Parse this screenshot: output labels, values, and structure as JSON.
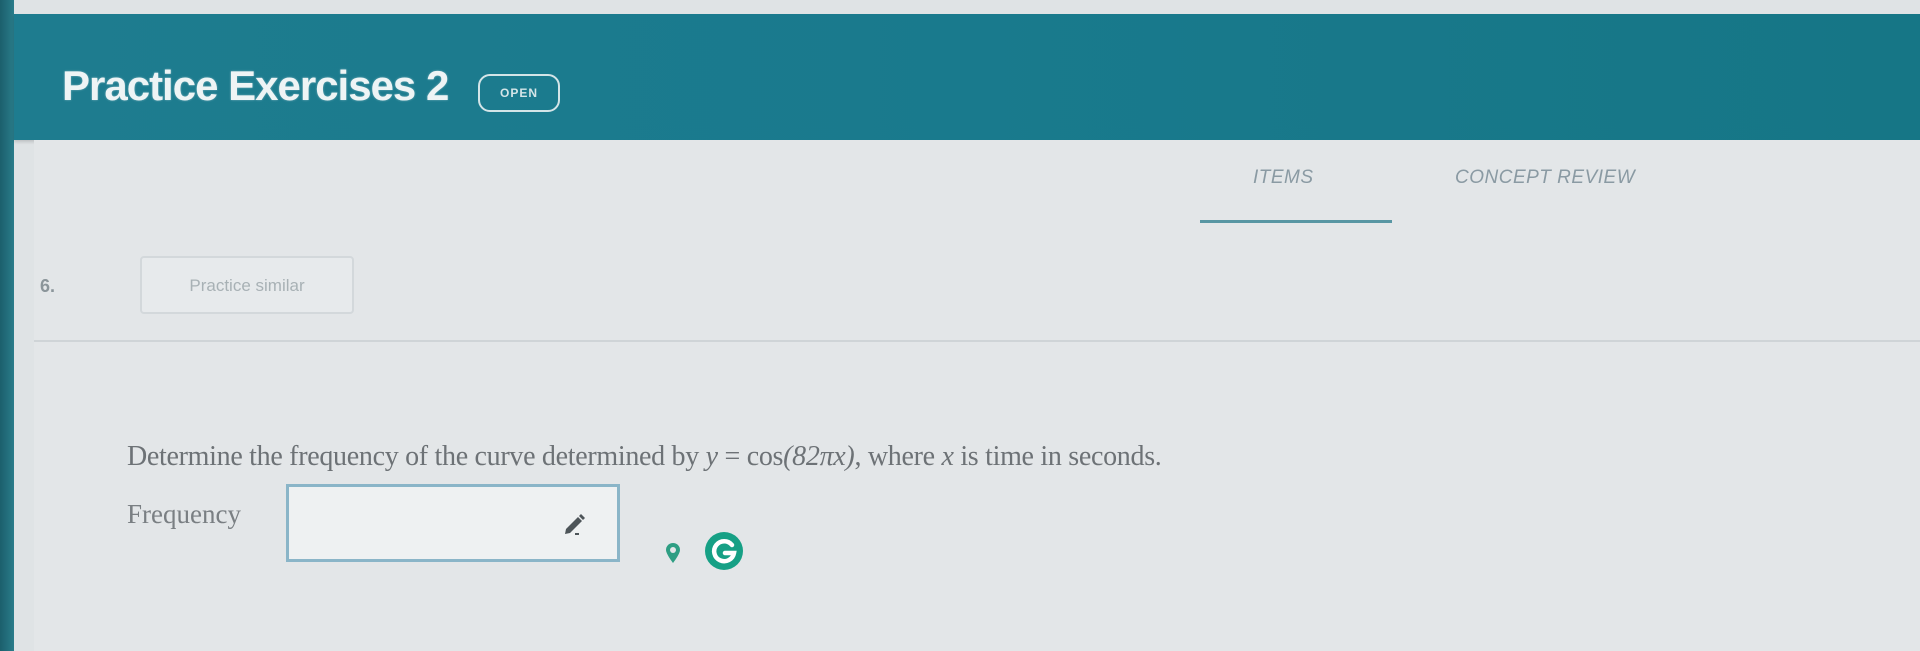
{
  "header": {
    "title": "Practice Exercises 2",
    "status_badge": "OPEN"
  },
  "tabs": [
    {
      "label": "ITEMS",
      "active": true
    },
    {
      "label": "CONCEPT REVIEW",
      "active": false
    }
  ],
  "item": {
    "number": "6.",
    "practice_similar_label": "Practice similar"
  },
  "question": {
    "prefix": "Determine the frequency of the curve determined by",
    "equation_y": "y",
    "equation_eq": " = ",
    "equation_cos": "cos",
    "equation_arg": "(82πx)",
    "middle": ", where",
    "variable": "x",
    "suffix": "is time in seconds."
  },
  "answer": {
    "label": "Frequency",
    "value": ""
  },
  "icons": {
    "edit": "pencil-icon",
    "hint": "location-pin-icon",
    "grammar": "grammarly-icon"
  },
  "colors": {
    "header_bg": "#1e7c8f",
    "accent": "#3f8797",
    "input_border": "#8ab5c8",
    "grammarly": "#16a085"
  }
}
